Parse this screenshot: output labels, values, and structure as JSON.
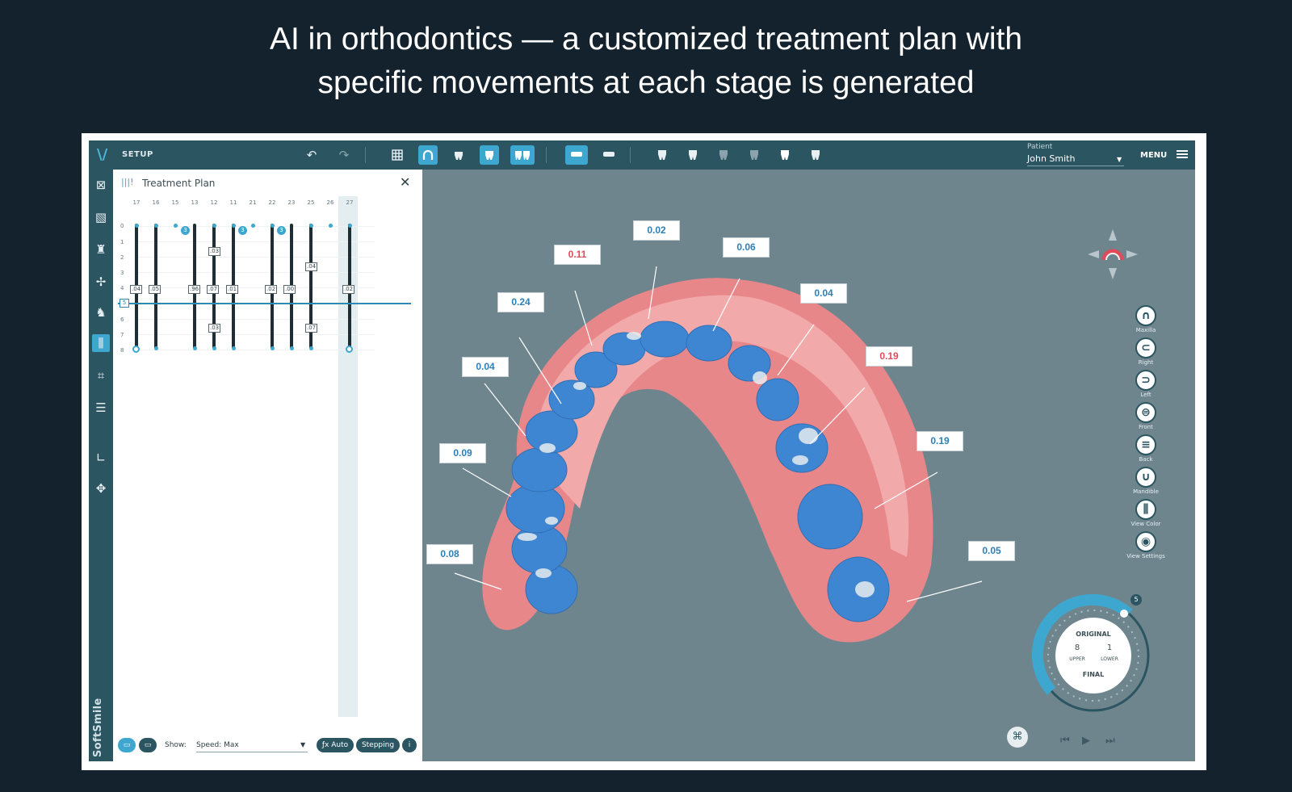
{
  "headline": {
    "line1": "AI in orthodontics — a customized treatment plan with",
    "line2": "specific movements at each stage is generated"
  },
  "topbar": {
    "section_label": "SETUP",
    "patient_label": "Patient",
    "patient_name": "John Smith",
    "menu_label": "MENU"
  },
  "treatment_plan": {
    "title": "Treatment Plan",
    "tooth_numbers": [
      "17",
      "16",
      "15",
      "13",
      "12",
      "11",
      "21",
      "22",
      "23",
      "25",
      "26",
      "27"
    ],
    "stages": [
      "0",
      "1",
      "2",
      "3",
      "4",
      "5",
      "6",
      "7",
      "8"
    ],
    "current_stage": "5",
    "step_values": {
      "row4": [
        ".04",
        ".05",
        ".96",
        ".07",
        ".01",
        ".02",
        ".00",
        ".02"
      ],
      "s12_row1": ".03",
      "s23_row2": ".04",
      "s12_row6": ".03",
      "s23_row6": ".07"
    },
    "dot_labels": [
      "3",
      "3",
      "3"
    ],
    "footer": {
      "show_label": "Show:",
      "show_value": "Speed: Max",
      "auto_label": "ƒx Auto",
      "stepping_label": "Stepping"
    }
  },
  "viewport": {
    "movement_labels": [
      {
        "value": "0.02",
        "color": "blue"
      },
      {
        "value": "0.11",
        "color": "red"
      },
      {
        "value": "0.06",
        "color": "blue"
      },
      {
        "value": "0.24",
        "color": "blue"
      },
      {
        "value": "0.04",
        "color": "blue"
      },
      {
        "value": "0.04",
        "color": "blue"
      },
      {
        "value": "0.19",
        "color": "red"
      },
      {
        "value": "0.09",
        "color": "blue"
      },
      {
        "value": "0.19",
        "color": "blue"
      },
      {
        "value": "0.08",
        "color": "blue"
      },
      {
        "value": "0.05",
        "color": "blue"
      }
    ],
    "view_tools": [
      "Maxilla",
      "Right",
      "Left",
      "Front",
      "Back",
      "Mandible",
      "View Color",
      "View Settings"
    ],
    "dial": {
      "top_label": "ORIGINAL",
      "bottom_label": "FINAL",
      "upper_count": "8",
      "lower_count": "1",
      "upper_label": "UPPER",
      "lower_label": "LOWER",
      "badge": "5"
    }
  },
  "colors": {
    "accent": "#3ea7d0",
    "chrome": "#2c5562",
    "viewport_bg": "#6e858e",
    "label_blue": "#2d7fb6",
    "label_red": "#e04b5a",
    "gum": "#e8878a",
    "tooth": "#3f86d2"
  },
  "brand": "SoftSmile"
}
